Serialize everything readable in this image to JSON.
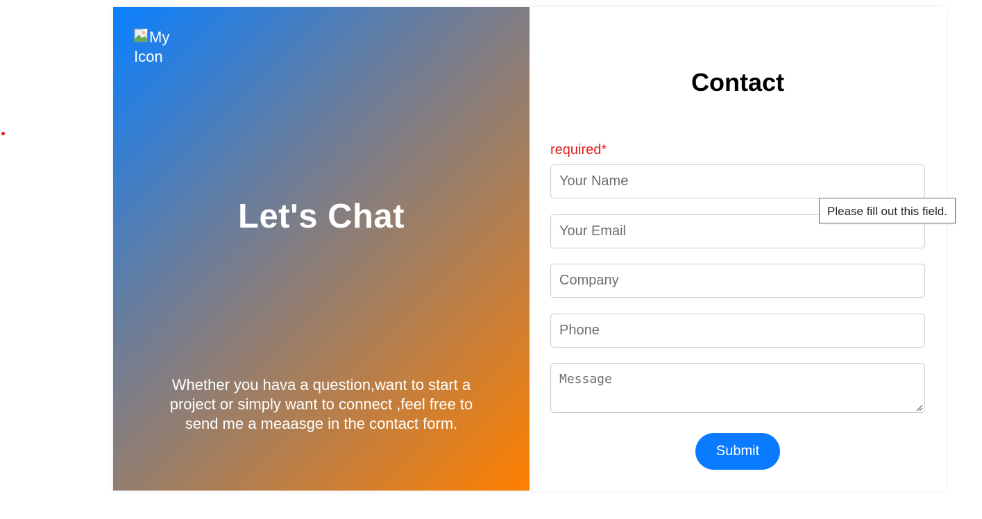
{
  "left": {
    "image_alt": "My Icon",
    "headline": "Let's Chat",
    "blurb": "Whether you hava a question,want to start a project or simply want to connect ,feel free to send me a meaasge in the contact form."
  },
  "form": {
    "title": "Contact",
    "required_label": "required*",
    "name_placeholder": "Your Name",
    "email_placeholder": "Your Email",
    "company_placeholder": "Company",
    "phone_placeholder": "Phone",
    "message_placeholder": "Message",
    "submit_label": "Submit"
  },
  "tooltip": {
    "text": "Please fill out this field."
  },
  "colors": {
    "accent": "#0a7bff",
    "required": "#e01b1b",
    "gradient_start": "#0a80ff",
    "gradient_end": "#ff8000"
  },
  "icons": {
    "broken_image": "broken-image-icon",
    "resize": "resize-grip-icon"
  }
}
